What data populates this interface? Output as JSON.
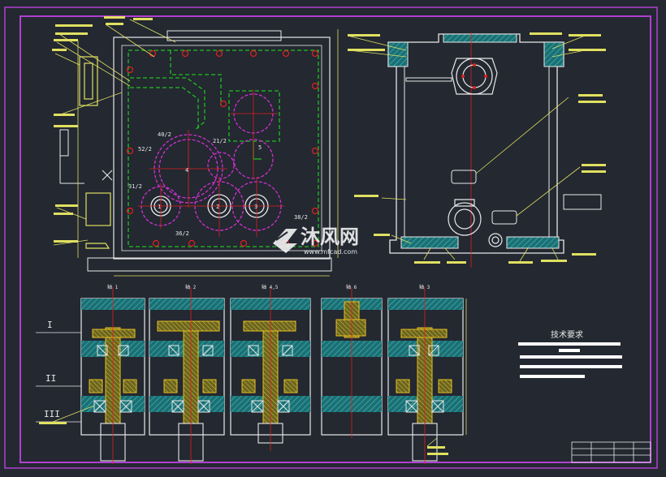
{
  "drawing": {
    "technical_requirements_title": "技术要求",
    "gear_labels": {
      "g40_2": "40/2",
      "g52_2": "52/2",
      "g31_2": "31/2",
      "g21_2": "21/2",
      "g5": "5",
      "g36_2": "36/2",
      "g38_2": "38/2",
      "r1": "1",
      "r2": "2",
      "r3": "3",
      "r4": "4"
    },
    "section_labels": {
      "axis1": "轴 1",
      "axis2": "轴 2",
      "axis45": "轴 4,5",
      "axis6": "轴 6",
      "axis3": "轴 3"
    },
    "roman_labels": [
      "I",
      "II",
      "III"
    ],
    "watermark": {
      "brand": "沐风网",
      "url": "www.mfcad.com"
    }
  },
  "colors": {
    "background": "#232831",
    "frame": "#b040d0",
    "outline": "#e8e8e8",
    "hidden": "#20c020",
    "center": "#e02020",
    "gear": "#d030d0",
    "leader": "#e0e060",
    "hatch": "#30a0a0",
    "shaft": "#e8c020"
  }
}
